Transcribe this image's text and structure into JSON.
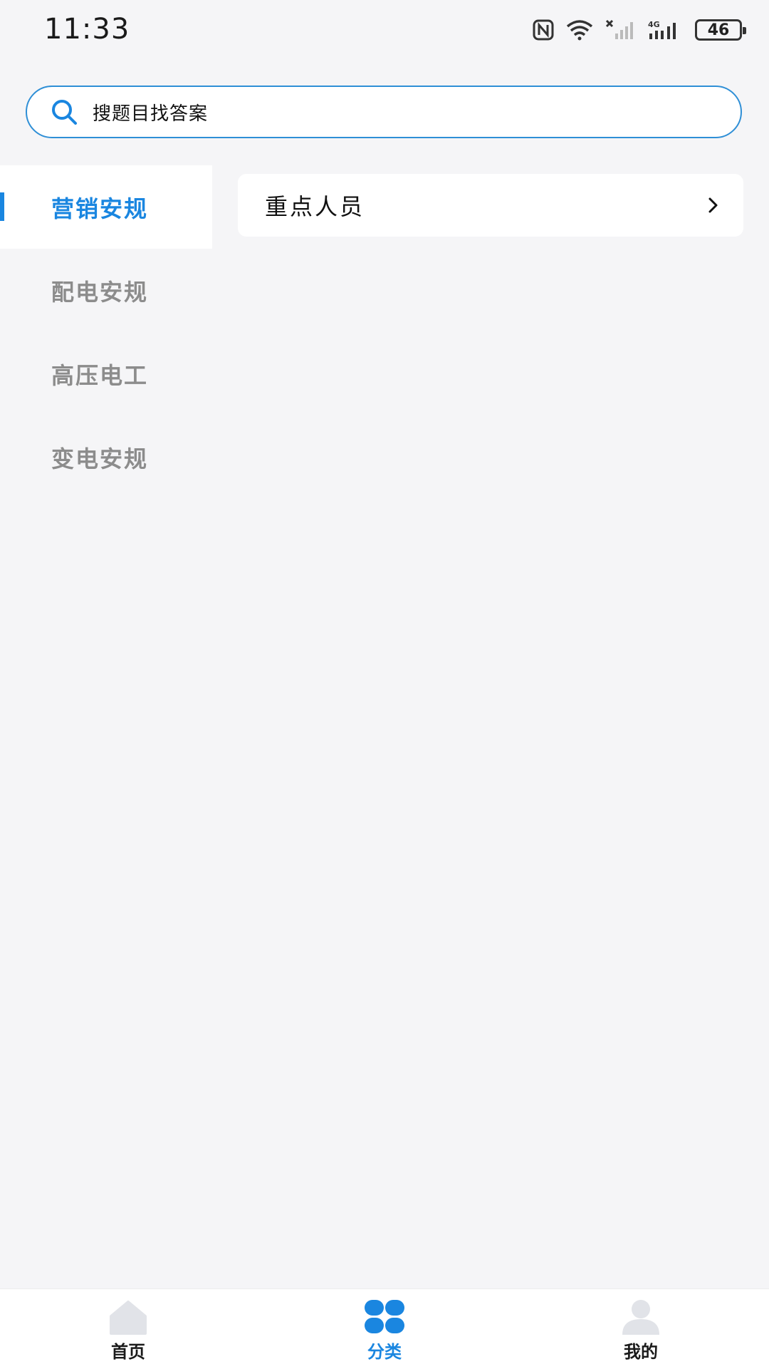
{
  "status_bar": {
    "time": "11:33",
    "battery": "46",
    "network": "4G"
  },
  "search": {
    "placeholder": "搜题目找答案"
  },
  "categories": [
    {
      "label": "营销安规",
      "active": true
    },
    {
      "label": "配电安规",
      "active": false
    },
    {
      "label": "高压电工",
      "active": false
    },
    {
      "label": "变电安规",
      "active": false
    }
  ],
  "topics": [
    {
      "label": "重点人员",
      "chevron": ">"
    }
  ],
  "bottom_nav": [
    {
      "label": "首页",
      "icon": "home-icon",
      "active": false
    },
    {
      "label": "分类",
      "icon": "category-icon",
      "active": true
    },
    {
      "label": "我的",
      "icon": "profile-icon",
      "active": false
    }
  ],
  "colors": {
    "accent": "#1a86e0",
    "inactive_text": "#8c8c8c",
    "background": "#f5f5f7"
  }
}
